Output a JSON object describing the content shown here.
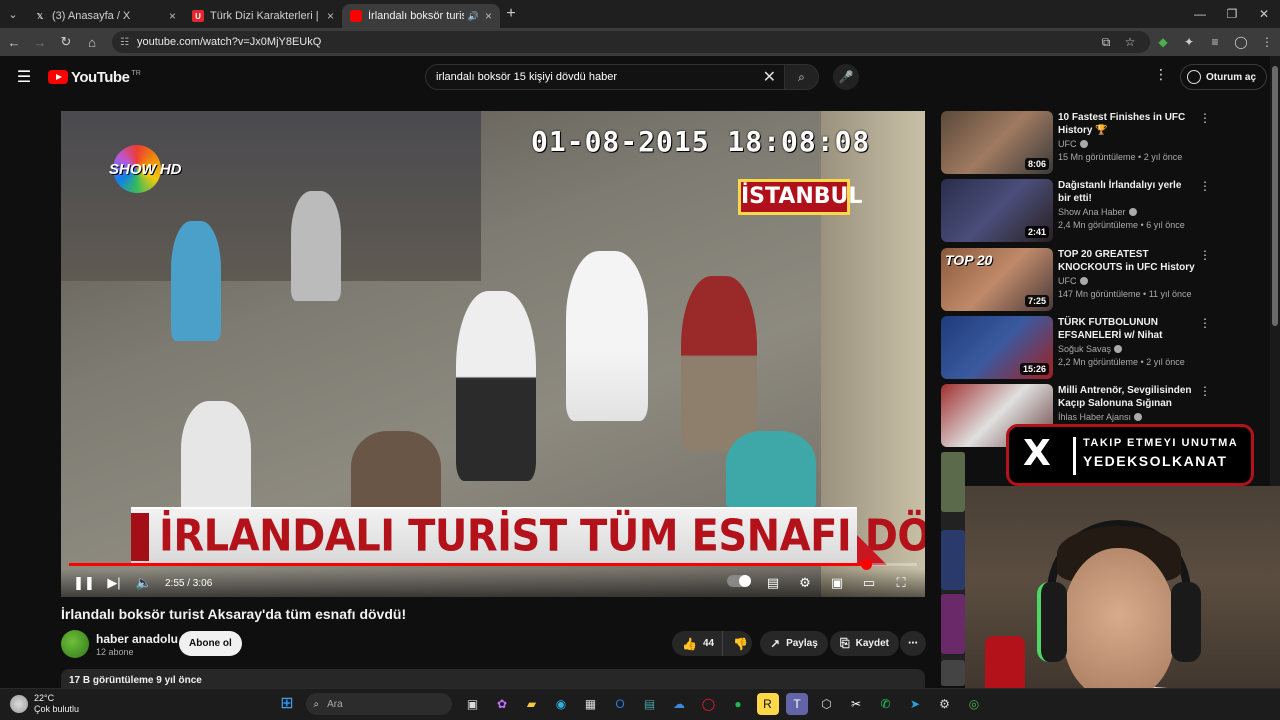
{
  "browser": {
    "tabs": [
      {
        "label": "(3) Anasayfa / X",
        "icon": "x-logo-icon"
      },
      {
        "label": "Türk Dizi Karakterleri | UwUFUFU",
        "icon": "uwufufu-icon"
      },
      {
        "label": "İrlandalı boksör turist Aksaray",
        "icon": "youtube-icon",
        "active": true
      }
    ],
    "new_tab": "+",
    "url": "youtube.com/watch?v=Jx0MjY8EUkQ"
  },
  "youtube": {
    "logo_text": "YouTube",
    "logo_country": "TR",
    "search_query": "irlandalı boksör 15 kişiyi dövdü haber",
    "signin_label": "Oturum aç"
  },
  "player": {
    "timestamp_overlay": "01-08-2015 18:08:08",
    "city_badge": "İSTANBUL",
    "channel_logo": "SHOW HD",
    "banner_text": "İRLANDALI TURİST TÜM ESNAFI DÖVDÜ!",
    "time_display": "2:55 / 3:06",
    "progress_fraction": 0.94
  },
  "video": {
    "title": "İrlandalı boksör turist Aksaray'da tüm esnafı dövdü!",
    "channel": "haber anadolu",
    "subscribers": "12 abone",
    "subscribe_label": "Abone ol",
    "likes": "44",
    "share_label": "Paylaş",
    "save_label": "Kaydet",
    "views_date": "17 B görüntüleme  9 yıl önce"
  },
  "recommendations": [
    {
      "title": "10 Fastest Finishes in UFC History 🏆",
      "channel": "UFC",
      "meta": "15 Mn görüntüleme • 2 yıl önce",
      "duration": "8:06",
      "color": "#7a5a48"
    },
    {
      "title": "Dağıstanlı İrlandalıyı yerle bir etti!",
      "channel": "Show Ana Haber",
      "meta": "2,4 Mn görüntüleme • 6 yıl önce",
      "duration": "2:41",
      "color": "#3b3f63"
    },
    {
      "title": "TOP 20 GREATEST KNOCKOUTS in UFC History ...",
      "channel": "UFC",
      "meta": "147 Mn görüntüleme • 11 yıl önce",
      "duration": "7:25",
      "color": "#8a5a3a",
      "overlay": "TOP 20"
    },
    {
      "title": "TÜRK FUTBOLUNUN EFSANELERİ w/ Nihat Kahveci,...",
      "channel": "Soğuk Savaş",
      "meta": "2,2 Mn görüntüleme • 2 yıl önce",
      "duration": "15:26",
      "color": "#1f3c7a"
    },
    {
      "title": "Milli Antrenör, Sevgilisinden Kaçıp Salonuna Sığınan Kadın...",
      "channel": "İhlas Haber Ajansı",
      "meta": "",
      "duration": "",
      "color": "#6a4040"
    }
  ],
  "overlay": {
    "x_line1": "TAKIP ETMEYI UNUTMA",
    "x_line2": "YEDEKSOLKANAT",
    "x_glyph": "X"
  },
  "taskbar": {
    "temp": "22°C",
    "weather": "Çok bulutlu",
    "search_placeholder": "Ara"
  }
}
